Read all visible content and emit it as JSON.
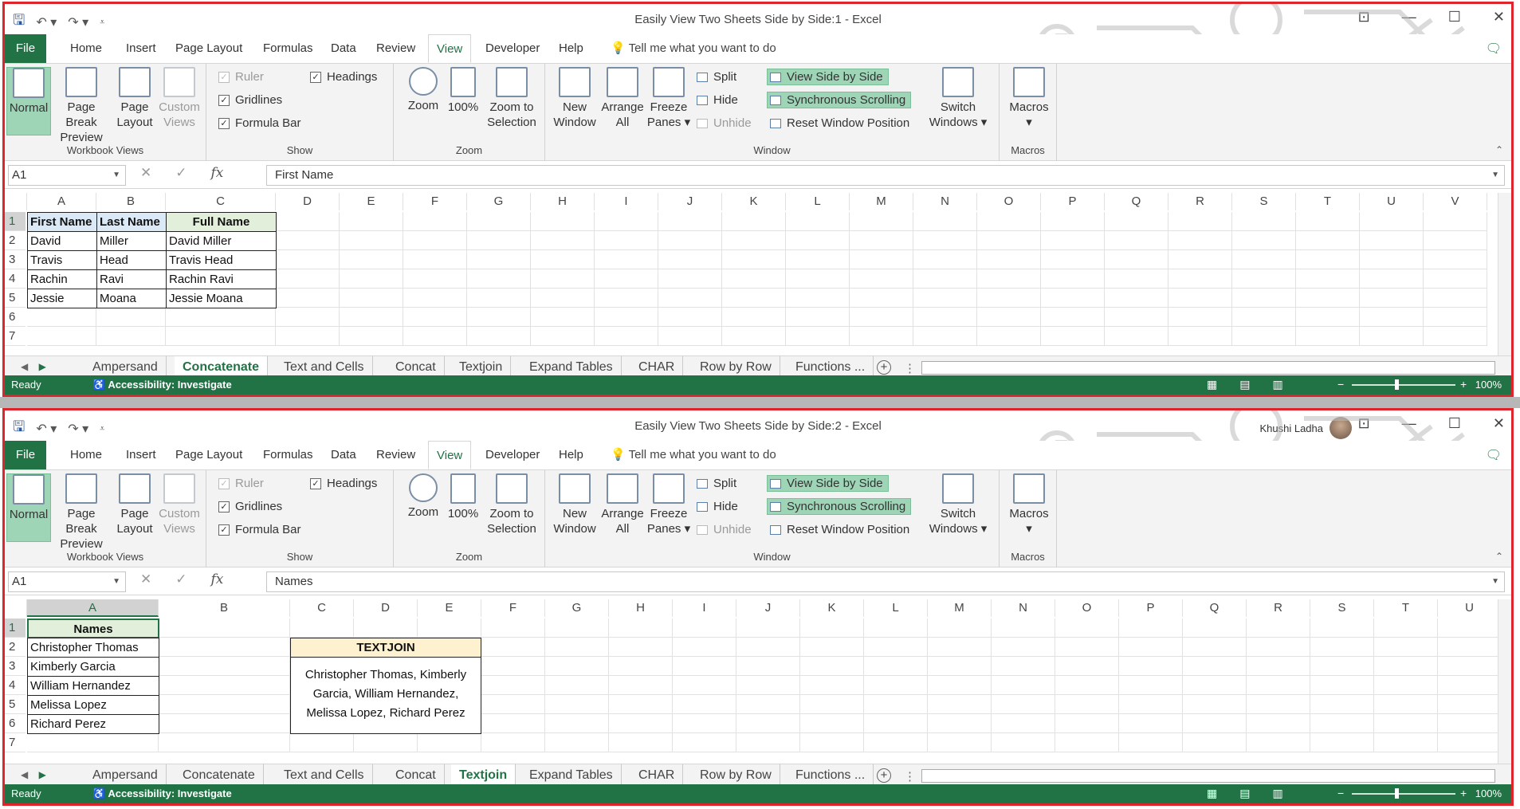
{
  "ribbon": {
    "file_tab": "File",
    "tabs": [
      "Home",
      "Insert",
      "Page Layout",
      "Formulas",
      "Data",
      "Review",
      "View",
      "Developer",
      "Help"
    ],
    "active_tab": "View",
    "tell_me": "Tell me what you want to do",
    "workbook_views": {
      "label": "Workbook Views",
      "normal": "Normal",
      "page_break": "Page Break Preview",
      "page_layout": "Page Layout",
      "custom": "Custom Views"
    },
    "show": {
      "label": "Show",
      "ruler": "Ruler",
      "gridlines": "Gridlines",
      "formula_bar": "Formula Bar",
      "headings": "Headings"
    },
    "zoom": {
      "label": "Zoom",
      "zoom": "Zoom",
      "hundred": "100%",
      "zoom_sel": "Zoom to Selection"
    },
    "window": {
      "label": "Window",
      "new_window": "New Window",
      "arrange_all": "Arrange All",
      "freeze": "Freeze Panes",
      "split": "Split",
      "hide": "Hide",
      "unhide": "Unhide",
      "side_by_side": "View Side by Side",
      "sync_scroll": "Synchronous Scrolling",
      "reset_pos": "Reset Window Position",
      "switch": "Switch Windows"
    },
    "macros": {
      "label": "Macros",
      "macros": "Macros"
    }
  },
  "sheet_tabs": [
    "Ampersand",
    "Concatenate",
    "Text and Cells",
    "Concat",
    "Textjoin",
    "Expand Tables",
    "CHAR",
    "Row by Row",
    "Functions ..."
  ],
  "status": {
    "ready": "Ready",
    "accessibility": "Accessibility: Investigate",
    "zoom": "100%"
  },
  "window1": {
    "title": "Easily View Two Sheets Side by Side:1  -  Excel",
    "name_box": "A1",
    "formula": "First Name",
    "active_sheet": "Concatenate",
    "columns": [
      "A",
      "B",
      "C",
      "D",
      "E",
      "F",
      "G",
      "H",
      "I",
      "J",
      "K",
      "L",
      "M",
      "N",
      "O",
      "P",
      "Q",
      "R",
      "S",
      "T",
      "U",
      "V"
    ],
    "rows": [
      "1",
      "2",
      "3",
      "4",
      "5",
      "6",
      "7"
    ],
    "headers": [
      "First Name",
      "Last Name",
      "Full Name"
    ],
    "data": [
      [
        "David",
        "Miller",
        "David Miller"
      ],
      [
        "Travis",
        "Head",
        "Travis Head"
      ],
      [
        "Rachin",
        "Ravi",
        "Rachin Ravi"
      ],
      [
        "Jessie",
        "Moana",
        "Jessie Moana"
      ]
    ]
  },
  "window2": {
    "title": "Easily View Two Sheets Side by Side:2  -  Excel",
    "user": "Khushi Ladha",
    "name_box": "A1",
    "formula": "Names",
    "active_sheet": "Textjoin",
    "columns": [
      "A",
      "B",
      "C",
      "D",
      "E",
      "F",
      "G",
      "H",
      "I",
      "J",
      "K",
      "L",
      "M",
      "N",
      "O",
      "P",
      "Q",
      "R",
      "S",
      "T",
      "U"
    ],
    "rows": [
      "1",
      "2",
      "3",
      "4",
      "5",
      "6",
      "7"
    ],
    "names_header": "Names",
    "names": [
      "Christopher Thomas",
      "Kimberly Garcia",
      "William Hernandez",
      "Melissa Lopez",
      "Richard Perez"
    ],
    "textjoin_header": "TEXTJOIN",
    "textjoin_lines": [
      "Christopher Thomas, Kimberly",
      "Garcia, William Hernandez,",
      "Melissa Lopez, Richard Perez"
    ]
  },
  "colors": {
    "excel_green": "#217346",
    "highlight": "#9fd5b7",
    "header_fill_1": "#dbe9f7",
    "header_fill_2": "#e2efda",
    "textjoin_fill": "#fdf1cf",
    "frame": "#e0242c"
  }
}
